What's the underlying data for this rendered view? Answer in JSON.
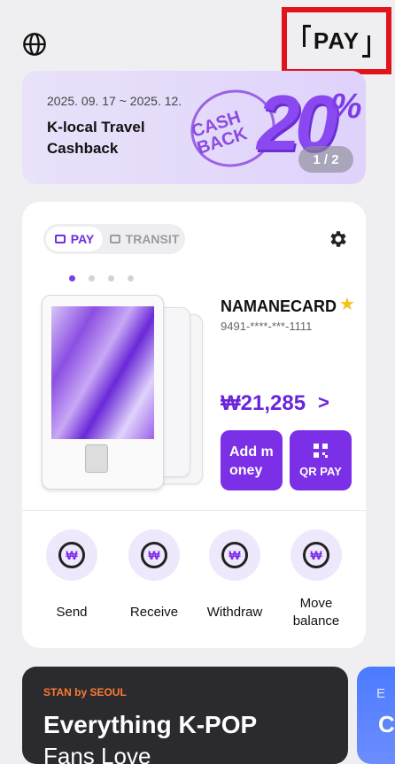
{
  "header": {
    "globe_icon": "globe-icon",
    "pay_logo": "PAY"
  },
  "banner": {
    "date": "2025. 09. 17 ~ 2025. 12.",
    "title": "K-local Travel Cashback",
    "badge": "CASH BACK",
    "percent_number": "20",
    "percent_sign": "%",
    "pager": "1 / 2"
  },
  "card_panel": {
    "tabs": [
      {
        "label": "PAY"
      },
      {
        "label": "TRANSIT"
      }
    ],
    "card_name": "NAMANECARD",
    "card_number": "9491-****-***-1111",
    "balance": "₩21,285",
    "balance_arrow": ">",
    "add_money_line1": "Add m",
    "add_money_line2": "oney",
    "qr_pay": "QR PAY",
    "actions": [
      {
        "label": "Send"
      },
      {
        "label": "Receive"
      },
      {
        "label": "Withdraw"
      },
      {
        "label": "Move balance"
      }
    ]
  },
  "promos": [
    {
      "brand": "STAN by SEOUL",
      "headline": "Everything K-POP",
      "sub": "Fans Love"
    },
    {
      "t1": "E",
      "t2": "C"
    }
  ],
  "colors": {
    "accent": "#7b2fe6",
    "banner_bg": "#e9e2fa",
    "promo_bg": "#2b2b2f",
    "highlight_border": "#e1141c"
  }
}
